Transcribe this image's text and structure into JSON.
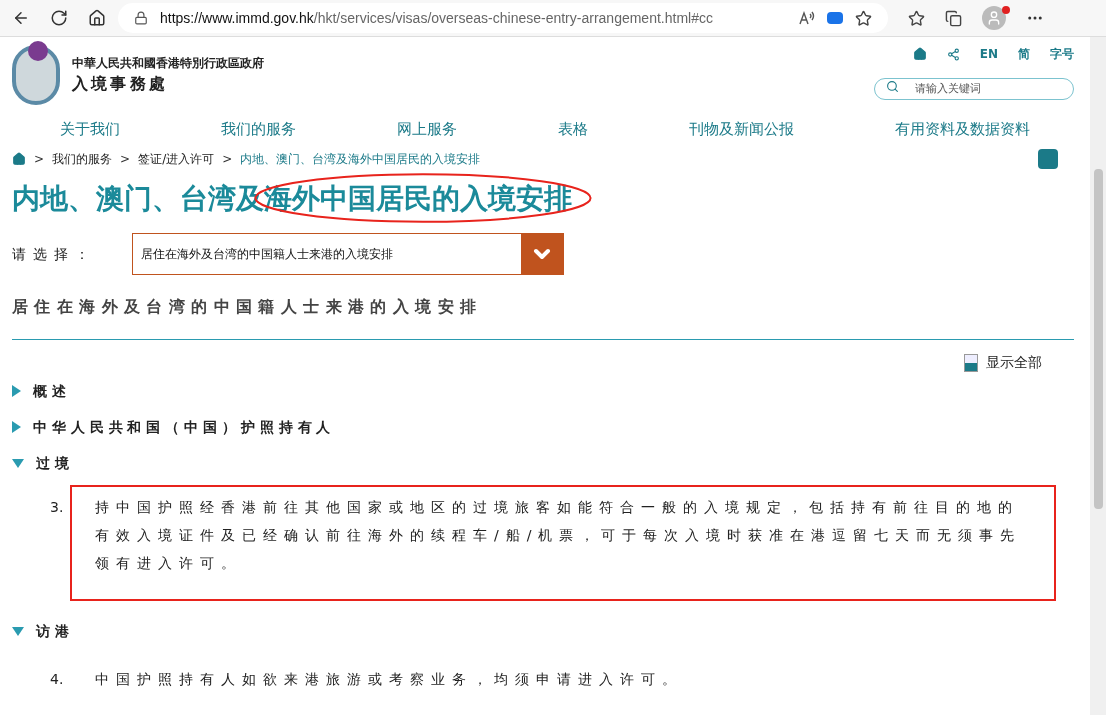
{
  "browser": {
    "url_host": "https://www.immd.gov.hk",
    "url_path": "/hkt/services/visas/overseas-chinese-entry-arrangement.html#cc",
    "profile_alert": true
  },
  "header": {
    "org_line": "中華人民共和國香港特別行政區政府",
    "dept": "入境事務處",
    "tools": [
      "EN",
      "简",
      "字号"
    ],
    "search": {
      "placeholder": "请输入关键词"
    }
  },
  "nav": [
    "关于我们",
    "我们的服务",
    "网上服务",
    "表格",
    "刊物及新闻公报",
    "有用资料及数据资料"
  ],
  "breadcrumb_separator": ">",
  "breadcrumb": [
    "我们的服务",
    "签证/进入许可",
    "内地、澳门、台湾及海外中国居民的入境安排"
  ],
  "title": [
    {
      "text": "内地、澳门、台湾及",
      "circled": false
    },
    {
      "text": "海外中国居民的入境安排",
      "circled": true
    }
  ],
  "select": {
    "label": "请选择：",
    "value": "居住在海外及台湾的中国籍人士来港的入境安排"
  },
  "subtitle": "居住在海外及台湾的中国籍人士来港的入境安排",
  "show_all": "显示全部",
  "sections": [
    {
      "title": "概述",
      "expanded": false
    },
    {
      "title": "中华人民共和国（中国）护照持有人",
      "expanded": false
    },
    {
      "title": "过境",
      "expanded": true,
      "paragraphs": [
        {
          "number": "3.",
          "text": "持中国护照经香港前往其他国家或地区的过境旅客如能符合一般的入境规定，包括持有前往目的地的有效入境证件及已经确认前往海外的续程车/船/机票，可于每次入境时获准在港逗留七天而无须事先领有进入许可。",
          "boxed": true
        }
      ]
    },
    {
      "title": "访港",
      "expanded": true,
      "paragraphs": [
        {
          "number": "4.",
          "text": "中国护照持有人如欲来港旅游或考察业务，均须申请进入许可。",
          "boxed": false
        }
      ]
    }
  ]
}
